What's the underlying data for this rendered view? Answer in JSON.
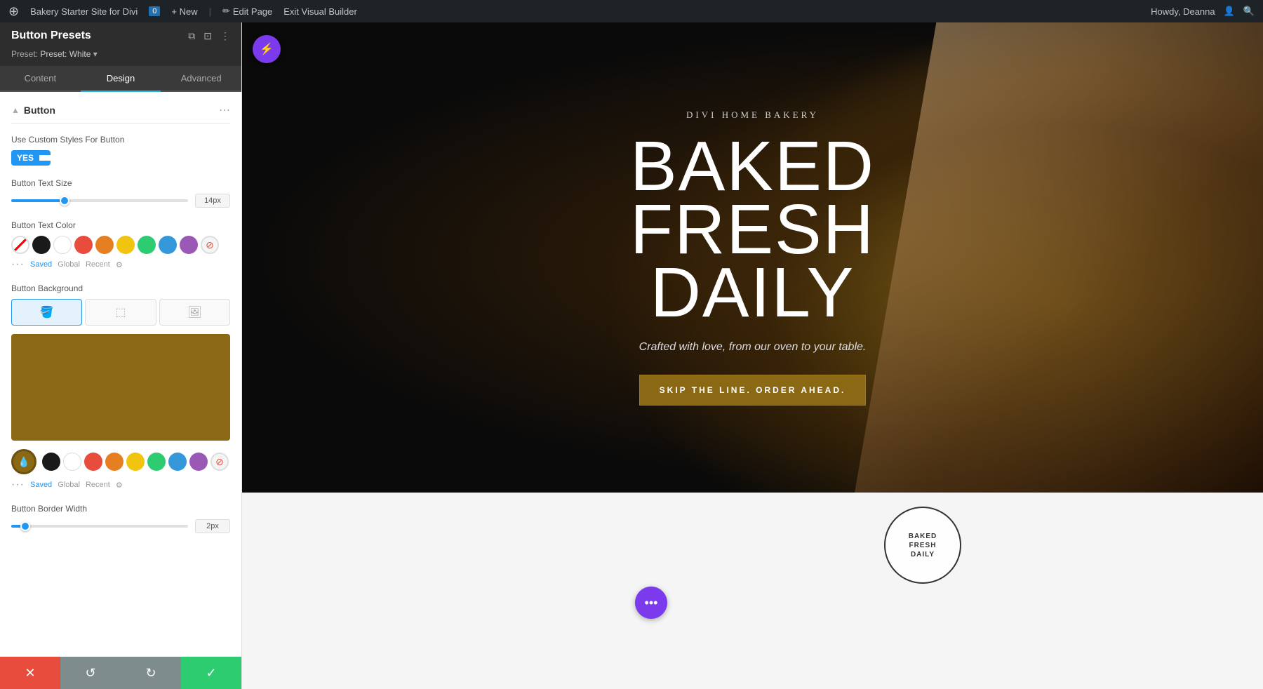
{
  "adminBar": {
    "wpIcon": "⊕",
    "siteName": "Bakery Starter Site for Divi",
    "commentCount": "0",
    "newLabel": "+ New",
    "editPage": "Edit Page",
    "exitBuilder": "Exit Visual Builder",
    "userGreeting": "Howdy, Deanna",
    "searchIcon": "🔍"
  },
  "panel": {
    "title": "Button Presets",
    "presetLabel": "Preset: White",
    "presetArrow": "▾",
    "tabs": [
      {
        "id": "content",
        "label": "Content"
      },
      {
        "id": "design",
        "label": "Design"
      },
      {
        "id": "advanced",
        "label": "Advanced"
      }
    ],
    "activeTab": "design",
    "collapseIcon": "▲",
    "moreIcon": "⋯",
    "icons": [
      "⧉",
      "⊡",
      "⋮"
    ]
  },
  "buttonSection": {
    "title": "Button",
    "customStylesLabel": "Use Custom Styles For\nButton",
    "toggleYes": "YES",
    "toggleNo": "",
    "textSizeLabel": "Button Text Size",
    "textSizeValue": "14px",
    "textSliderPercent": 30,
    "textColorLabel": "Button Text Color",
    "colors": [
      {
        "name": "transparent",
        "value": "transparent"
      },
      {
        "name": "black",
        "value": "#1a1a1a"
      },
      {
        "name": "white",
        "value": "#ffffff"
      },
      {
        "name": "red",
        "value": "#e74c3c"
      },
      {
        "name": "orange",
        "value": "#e67e22"
      },
      {
        "name": "yellow",
        "value": "#f1c40f"
      },
      {
        "name": "green",
        "value": "#2ecc71"
      },
      {
        "name": "blue",
        "value": "#3498db"
      },
      {
        "name": "purple",
        "value": "#9b59b6"
      },
      {
        "name": "pink-red",
        "value": "#e74c3c"
      }
    ],
    "savedLabel": "Saved",
    "globalLabel": "Global",
    "recentLabel": "Recent",
    "bgLabel": "Button Background",
    "bgOptions": [
      "solid",
      "gradient",
      "image"
    ],
    "bgColor": "#8B6914",
    "bottomColors": [
      {
        "name": "brown-eyedropper",
        "value": "#8B6914"
      },
      {
        "name": "black",
        "value": "#1a1a1a"
      },
      {
        "name": "white2",
        "value": "#ffffff"
      },
      {
        "name": "red2",
        "value": "#e74c3c"
      },
      {
        "name": "orange2",
        "value": "#e67e22"
      },
      {
        "name": "yellow2",
        "value": "#f1c40f"
      },
      {
        "name": "green2",
        "value": "#2ecc71"
      },
      {
        "name": "blue2",
        "value": "#3498db"
      },
      {
        "name": "purple2",
        "value": "#9b59b6"
      },
      {
        "name": "pink-red2",
        "value": "#e74c3c"
      }
    ],
    "borderWidthLabel": "Button Border Width",
    "borderWidthValue": "2px",
    "borderSliderPercent": 8
  },
  "bottomBar": {
    "closeIcon": "✕",
    "undoIcon": "↺",
    "redoIcon": "↻",
    "checkIcon": "✓"
  },
  "canvas": {
    "diviIcon": "⚡",
    "hero": {
      "tagline": "DIVI HOME BAKERY",
      "titleLine1": "BAKED FRESH",
      "titleLine2": "DAILY",
      "subtitle": "Crafted with love, from our oven to your table.",
      "ctaLabel": "SKIP THE LINE. ORDER AHEAD."
    },
    "stamp": {
      "line1": "BAKED",
      "line2": "FRESH",
      "line3": "DAILY"
    },
    "purpleFabIcon": "•••"
  }
}
